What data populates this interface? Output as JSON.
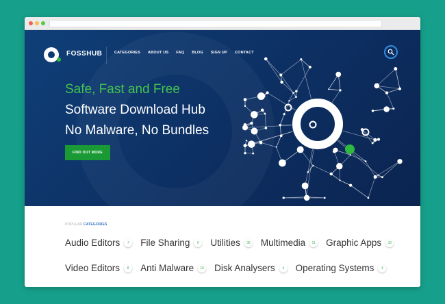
{
  "header": {
    "logo_text": "FOSSHUB",
    "nav": [
      "CATEGORIES",
      "ABOUT US",
      "FAQ",
      "BLOG",
      "SIGN UP",
      "CONTACT"
    ]
  },
  "hero": {
    "line1": "Safe, Fast and Free",
    "line2": "Software Download Hub",
    "line3": "No Malware, No Bundles",
    "cta": "FIND OUT MORE"
  },
  "categories": {
    "title_prefix": "POPULAR ",
    "title_highlight": "CATEGORIES",
    "row1": [
      {
        "name": "Audio Editors",
        "count": "7"
      },
      {
        "name": "File Sharing",
        "count": "6"
      },
      {
        "name": "Utilities",
        "count": "38"
      },
      {
        "name": "Multimedia",
        "count": "11"
      },
      {
        "name": "Graphic Apps",
        "count": "33"
      }
    ],
    "row2": [
      {
        "name": "Video Editors",
        "count": "8"
      },
      {
        "name": "Anti Malware",
        "count": "10"
      },
      {
        "name": "Disk Analysers",
        "count": "4"
      },
      {
        "name": "Operating Systems",
        "count": "4"
      }
    ]
  },
  "colors": {
    "background": "#16a08b",
    "hero": "#0e3a72",
    "accent_green": "#2dbb3f",
    "accent_blue": "#2f8fe0"
  }
}
